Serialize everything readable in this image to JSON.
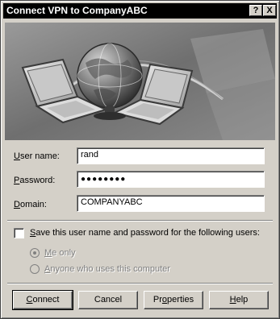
{
  "window": {
    "title": "Connect VPN to CompanyABC",
    "help_button": "?",
    "close_button": "X"
  },
  "banner": {
    "icons": [
      "globe-icon",
      "laptop-icon",
      "laptop-icon"
    ]
  },
  "form": {
    "username_label": {
      "a": "U",
      "b": "ser name:"
    },
    "username_value": "rand",
    "password_label": {
      "a": "P",
      "b": "assword:"
    },
    "password_value": "●●●●●●●●",
    "domain_label": {
      "a": "D",
      "b": "omain:"
    },
    "domain_value": "COMPANYABC"
  },
  "save": {
    "label": {
      "a": "S",
      "b": "ave this user name and password for the following users:"
    },
    "checked": false,
    "options": [
      {
        "a": "",
        "u": "M",
        "b": "e only",
        "selected": true
      },
      {
        "a": "",
        "u": "A",
        "b": "nyone who uses this computer",
        "selected": false
      }
    ]
  },
  "buttons": {
    "connect": {
      "u": "C",
      "b": "onnect"
    },
    "cancel": "Cancel",
    "properties": {
      "a": "Pr",
      "u": "o",
      "b": "perties"
    },
    "help": {
      "u": "H",
      "b": "elp"
    }
  }
}
